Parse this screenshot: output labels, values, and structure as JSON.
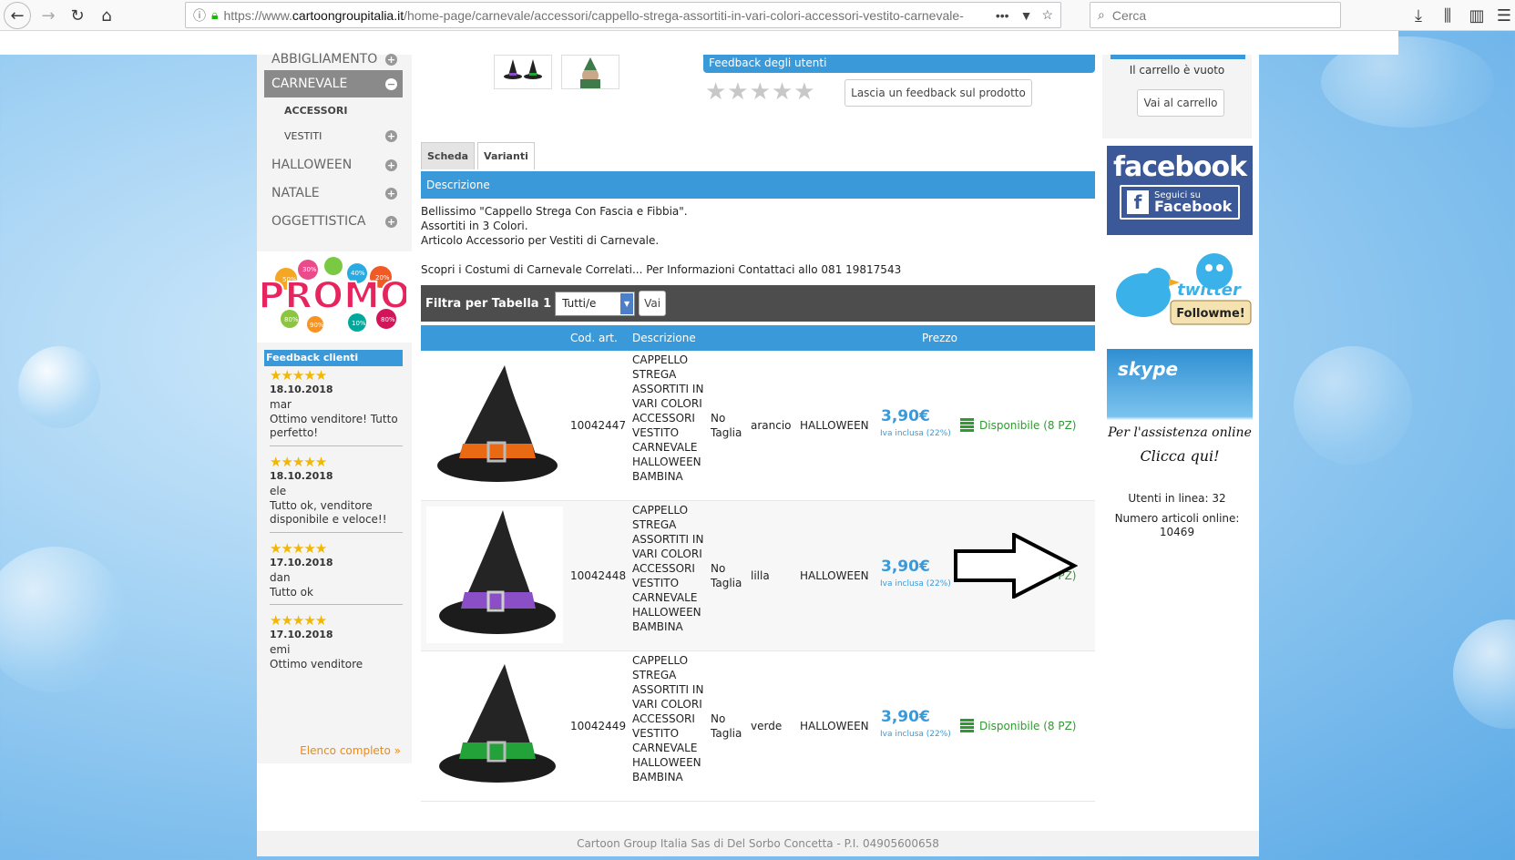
{
  "browser": {
    "url_prefix": "https://www.",
    "url_domain": "cartoongroupitalia.it",
    "url_path": "/home-page/carnevale/accessori/cappello-strega-assortiti-in-vari-colori-accessori-vestito-carnevale-",
    "search_placeholder": "Cerca"
  },
  "menu": {
    "items": [
      {
        "label": "ABBIGLIAMENTO",
        "icon": "plus"
      },
      {
        "label": "CARNEVALE",
        "icon": "minus"
      },
      {
        "label": "ACCESSORI"
      },
      {
        "label": "VESTITI",
        "icon": "plus"
      },
      {
        "label": "HALLOWEEN",
        "icon": "plus"
      },
      {
        "label": "NATALE",
        "icon": "plus"
      },
      {
        "label": "OGGETTISTICA",
        "icon": "plus"
      }
    ],
    "promo_label": "PROMO",
    "promo_badges": [
      "50%",
      "30%",
      "40%",
      "20%",
      "80%",
      "90%",
      "10%",
      "80%"
    ]
  },
  "feedback_clienti": {
    "title": "Feedback clienti",
    "entries": [
      {
        "stars": "★★★★★",
        "date": "18.10.2018",
        "name": "mar",
        "text": "Ottimo venditore! Tutto perfetto!"
      },
      {
        "stars": "★★★★★",
        "date": "18.10.2018",
        "name": "ele",
        "text": "Tutto ok, venditore disponibile e veloce!!"
      },
      {
        "stars": "★★★★★",
        "date": "17.10.2018",
        "name": "dan",
        "text": "Tutto ok"
      },
      {
        "stars": "★★★★★",
        "date": "17.10.2018",
        "name": "emi",
        "text": "Ottimo venditore"
      }
    ],
    "link_all": "Elenco completo »"
  },
  "product": {
    "feedback_users_title": "Feedback degli utenti",
    "grey_stars": "★★★★★",
    "leave_feedback_button": "Lascia un feedback sul prodotto",
    "tabs": [
      "Scheda",
      "Varianti"
    ],
    "description_title": "Descrizione",
    "description_lines": [
      "Bellissimo \"Cappello Strega Con Fascia e Fibbia\".",
      "Assortiti in 3 Colori.",
      "Articolo Accessorio per Vestiti di Carnevale.",
      "",
      "Scopri i Costumi di Carnevale Correlati... Per Informazioni Contattaci allo 081 19817543"
    ],
    "filter_label": "Filtra per Tabella 1",
    "filter_select_value": "Tutti/e",
    "filter_go": "Vai",
    "table_headers": {
      "code": "Cod. art.",
      "description": "Descrizione",
      "price": "Prezzo"
    },
    "rows": [
      {
        "code": "10042447",
        "description": "CAPPELLO STREGA ASSORTITI IN VARI COLORI ACCESSORI VESTITO CARNEVALE HALLOWEEN BAMBINA",
        "size": "No Taglia",
        "color": "arancio",
        "category": "HALLOWEEN",
        "price": "3,90€",
        "iva": "Iva inclusa (22%)",
        "availability": "Disponibile (8 PZ)",
        "band_color": "#e96a12"
      },
      {
        "code": "10042448",
        "description": "CAPPELLO STREGA ASSORTITI IN VARI COLORI ACCESSORI VESTITO CARNEVALE HALLOWEEN BAMBINA",
        "size": "No Taglia",
        "color": "lilla",
        "category": "HALLOWEEN",
        "price": "3,90€",
        "iva": "Iva inclusa (22%)",
        "availability": "Disponibile (8 PZ)",
        "band_color": "#8a4fc7"
      },
      {
        "code": "10042449",
        "description": "CAPPELLO STREGA ASSORTITI IN VARI COLORI ACCESSORI VESTITO CARNEVALE HALLOWEEN BAMBINA",
        "size": "No Taglia",
        "color": "verde",
        "category": "HALLOWEEN",
        "price": "3,90€",
        "iva": "Iva inclusa (22%)",
        "availability": "Disponibile (8 PZ)",
        "band_color": "#23a23a"
      }
    ]
  },
  "sidebar_right": {
    "cart_empty": "Il carrello è vuoto",
    "cart_button": "Vai al carrello",
    "facebook_logo": "facebook",
    "facebook_follow_top": "Seguici su",
    "facebook_follow_bottom": "Facebook",
    "twitter_logo": "twitter",
    "twitter_follow": "Followme!",
    "skype_logo": "skype",
    "skype_text_1": "Per l'assistenza online",
    "skype_text_2": "Clicca qui!",
    "online_users": "Utenti in linea: 32",
    "online_articles_label": "Numero articoli online:",
    "online_articles_value": "10469"
  },
  "footer": {
    "text": "Cartoon Group Italia Sas di Del Sorbo Concetta - P.I. 04905600658"
  },
  "colors": {
    "accent": "#3a9ad9",
    "available": "#2f9a2f",
    "rating": "#f2b705"
  }
}
